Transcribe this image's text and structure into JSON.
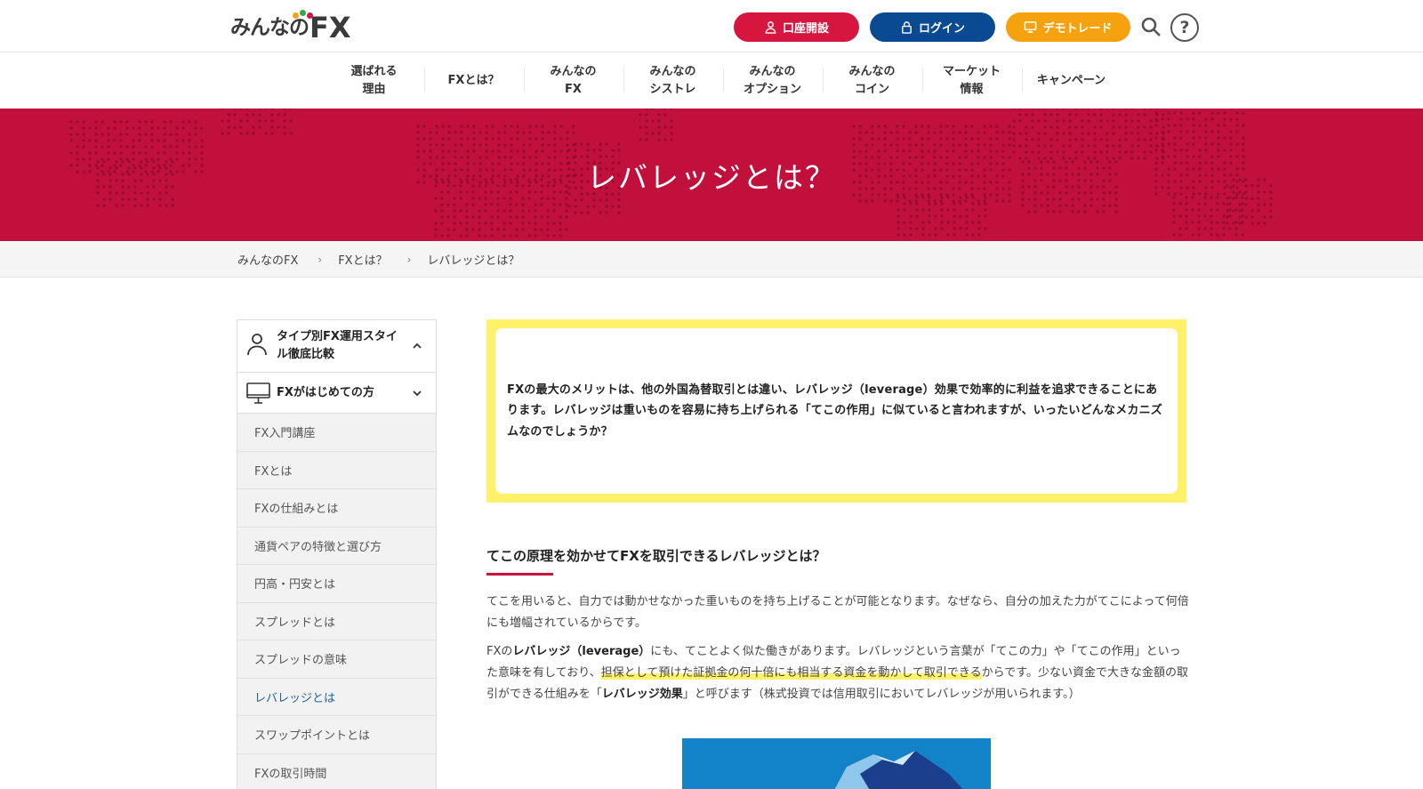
{
  "header": {
    "logo_jp": "みんなの",
    "logo_fx": "FX",
    "buttons": {
      "open_account": "口座開設",
      "login": "ログイン",
      "demo_trade": "デモトレード"
    },
    "help_label": "?"
  },
  "nav": {
    "items": [
      "選ばれる\n理由",
      "FXとは？",
      "みんなの\nFX",
      "みんなの\nシストレ",
      "みんなの\nオプション",
      "みんなの\nコイン",
      "マーケット\n情報",
      "キャンペーン"
    ]
  },
  "hero": {
    "title": "レバレッジとは？"
  },
  "breadcrumb": [
    "みんなのFX",
    "FXとは？",
    "レバレッジとは？"
  ],
  "breadcrumb_sep": "›",
  "sidebar": {
    "section1": "タイプ別FX運用スタイル徹底比較",
    "section2": "FXがはじめての方",
    "items": [
      "FX入門講座",
      "FXとは",
      "FXの仕組みとは",
      "通貨ペアの特徴と選び方",
      "円高・円安とは",
      "スプレッドとは",
      "スプレッドの意味",
      "レバレッジとは",
      "スワップポイントとは",
      "FXの取引時間"
    ],
    "active_index": 7
  },
  "main": {
    "intro": "FXの最大のメリットは、他の外国為替取引とは違い、レバレッジ（leverage）効果で効率的に利益を追求できることにあります。レバレッジは重いものを容易に持ち上げられる「てこの作用」に似ていると言われますが、いったいどんなメカニズムなのでしょうか？",
    "section_title": "てこの原理を効かせてFXを取引できるレバレッジとは？",
    "para1": "てこを用いると、自力では動かせなかった重いものを持ち上げることが可能となります。なぜなら、自分の加えた力がてこによって何倍にも増幅されているからです。",
    "para2": {
      "a": "FXの",
      "b_bold": "レバレッジ（leverage）",
      "c": "にも、てことよく似た働きがあります。レバレッジという言葉が「てこの力」や「てこの作用」といった意味を有しており、",
      "d_highlight": "担保として預けた証拠金の何十倍にも相当する資金を動かして取引できる",
      "e": "からです。少ない資金で大きな金額の取引ができる仕組みを「",
      "f_bold": "レバレッジ効果",
      "g": "」と呼びます（株式投資では信用取引においてレバレッジが用いられます。）"
    }
  },
  "colors": {
    "brand_red": "#c0103b",
    "open_btn": "#d7163f",
    "login_btn": "#0a4a92",
    "demo_btn": "#f6a20e",
    "highlight": "#fff26a",
    "active_link": "#1f62a8"
  }
}
